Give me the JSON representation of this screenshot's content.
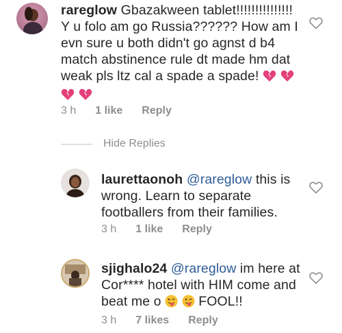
{
  "comments": [
    {
      "username": "rareglow",
      "text": "Gbazakween tablet!!!!!!!!!!!!!!! Y u folo am go Russia?????? How am I evn sure u both didn't go agnst d b4 match abstinence rule dt made hm dat weak pls ltz cal a spade a spade!",
      "time": "3 h",
      "likes": "1 like",
      "reply": "Reply",
      "icons": [
        "broken-heart-emoji",
        "broken-heart-emoji",
        "broken-heart-emoji",
        "broken-heart-emoji"
      ]
    }
  ],
  "hide_replies": "Hide Replies",
  "replies": [
    {
      "username": "laurettaonoh",
      "mention": "@rareglow",
      "text": "this is wrong. Learn to separate footballers from their families.",
      "time": "3 h",
      "likes": "1 like",
      "reply": "Reply"
    },
    {
      "username": "sjighalo24",
      "mention": "@rareglow",
      "text": "im here at Cor**** hotel with HIM come and beat me o",
      "text_end": "FOOL!!",
      "time": "3 h",
      "likes": "7 likes",
      "reply": "Reply",
      "icons": [
        "tongue-wink-emoji",
        "tongue-wink-emoji"
      ]
    }
  ],
  "colors": {
    "text": "#262626",
    "mention": "#2f5c97",
    "meta": "#8e8e8e",
    "heart_outline": "#8e8e8e",
    "broken_heart": "#e4407a"
  }
}
